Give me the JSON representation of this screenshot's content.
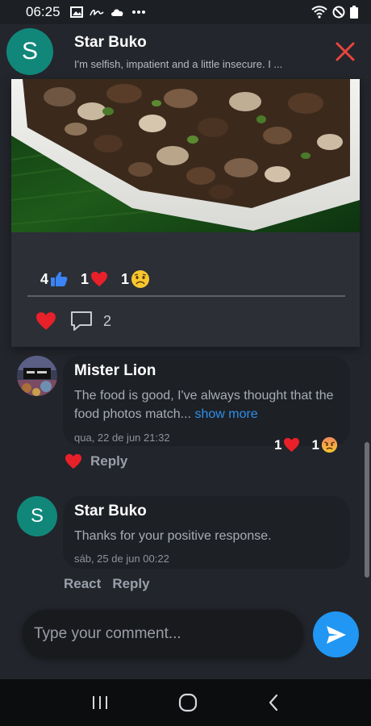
{
  "status_bar": {
    "time": "06:25"
  },
  "header": {
    "avatar_letter": "S",
    "name": "Star Buko",
    "subtitle": "I'm selfish, impatient and a little insecure. I ..."
  },
  "post": {
    "reactions": [
      {
        "count": "4",
        "icon": "thumbs-up-icon"
      },
      {
        "count": "1",
        "icon": "heart-icon"
      },
      {
        "count": "1",
        "icon": "sad-face-icon"
      }
    ],
    "comment_count": "2"
  },
  "comments": [
    {
      "author": "Mister Lion",
      "text": "The food is good, I've always thought that the food photos match...",
      "more": "show more",
      "date": "qua, 22 de jun 21:32",
      "reactions": [
        {
          "count": "1",
          "icon": "heart-icon"
        },
        {
          "count": "1",
          "icon": "angry-face-icon"
        }
      ],
      "reply_label": "Reply"
    },
    {
      "author": "Star Buko",
      "avatar_letter": "S",
      "text": "Thanks for your positive response.",
      "date": "sáb, 25 de jun 00:22",
      "react_label": "React",
      "reply_label": "Reply"
    }
  ],
  "composer": {
    "placeholder": "Type your comment..."
  },
  "colors": {
    "accent": "#2196f3",
    "avatar": "#11877a",
    "heart": "#e8202a",
    "close": "#e8453c",
    "link": "#2f90ea"
  }
}
